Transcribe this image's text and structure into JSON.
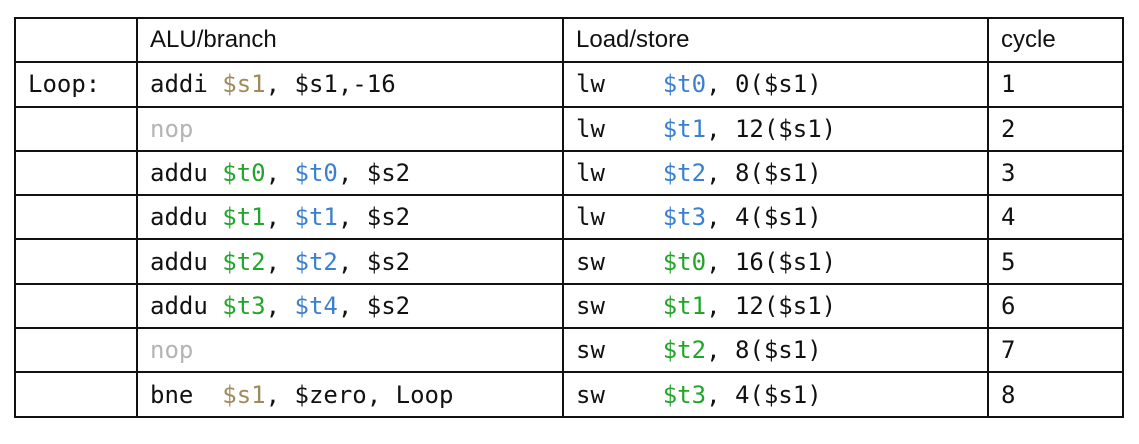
{
  "headers": [
    "",
    "ALU/branch",
    "Load/store",
    "cycle"
  ],
  "colors": {
    "plain": "#111111",
    "gold": "#a08a5a",
    "green": "#22a52a",
    "blue": "#3a7fd0",
    "gray": "#b4b4b4"
  },
  "rows": [
    {
      "label": "Loop:",
      "alu": [
        {
          "t": "addi ",
          "c": "plain"
        },
        {
          "t": "$s1",
          "c": "gold"
        },
        {
          "t": ", $s1,-16",
          "c": "plain"
        }
      ],
      "ls": [
        {
          "t": "lw    ",
          "c": "plain"
        },
        {
          "t": "$t0",
          "c": "blue"
        },
        {
          "t": ", 0($s1)",
          "c": "plain"
        }
      ],
      "cycle": "1"
    },
    {
      "label": "",
      "alu": [
        {
          "t": "nop",
          "c": "gray"
        }
      ],
      "ls": [
        {
          "t": "lw    ",
          "c": "plain"
        },
        {
          "t": "$t1",
          "c": "blue"
        },
        {
          "t": ", 12($s1)",
          "c": "plain"
        }
      ],
      "cycle": "2"
    },
    {
      "label": "",
      "alu": [
        {
          "t": "addu ",
          "c": "plain"
        },
        {
          "t": "$t0",
          "c": "green"
        },
        {
          "t": ", ",
          "c": "plain"
        },
        {
          "t": "$t0",
          "c": "blue"
        },
        {
          "t": ", $s2",
          "c": "plain"
        }
      ],
      "ls": [
        {
          "t": "lw    ",
          "c": "plain"
        },
        {
          "t": "$t2",
          "c": "blue"
        },
        {
          "t": ", 8($s1)",
          "c": "plain"
        }
      ],
      "cycle": "3"
    },
    {
      "label": "",
      "alu": [
        {
          "t": "addu ",
          "c": "plain"
        },
        {
          "t": "$t1",
          "c": "green"
        },
        {
          "t": ", ",
          "c": "plain"
        },
        {
          "t": "$t1",
          "c": "blue"
        },
        {
          "t": ", $s2",
          "c": "plain"
        }
      ],
      "ls": [
        {
          "t": "lw    ",
          "c": "plain"
        },
        {
          "t": "$t3",
          "c": "blue"
        },
        {
          "t": ", 4($s1)",
          "c": "plain"
        }
      ],
      "cycle": "4"
    },
    {
      "label": "",
      "alu": [
        {
          "t": "addu ",
          "c": "plain"
        },
        {
          "t": "$t2",
          "c": "green"
        },
        {
          "t": ", ",
          "c": "plain"
        },
        {
          "t": "$t2",
          "c": "blue"
        },
        {
          "t": ", $s2",
          "c": "plain"
        }
      ],
      "ls": [
        {
          "t": "sw    ",
          "c": "plain"
        },
        {
          "t": "$t0",
          "c": "green"
        },
        {
          "t": ", 16($s1)",
          "c": "plain"
        }
      ],
      "cycle": "5"
    },
    {
      "label": "",
      "alu": [
        {
          "t": "addu ",
          "c": "plain"
        },
        {
          "t": "$t3",
          "c": "green"
        },
        {
          "t": ", ",
          "c": "plain"
        },
        {
          "t": "$t4",
          "c": "blue"
        },
        {
          "t": ", $s2",
          "c": "plain"
        }
      ],
      "ls": [
        {
          "t": "sw    ",
          "c": "plain"
        },
        {
          "t": "$t1",
          "c": "green"
        },
        {
          "t": ", 12($s1)",
          "c": "plain"
        }
      ],
      "cycle": "6"
    },
    {
      "label": "",
      "alu": [
        {
          "t": "nop",
          "c": "gray"
        }
      ],
      "ls": [
        {
          "t": "sw    ",
          "c": "plain"
        },
        {
          "t": "$t2",
          "c": "green"
        },
        {
          "t": ", 8($s1)",
          "c": "plain"
        }
      ],
      "cycle": "7"
    },
    {
      "label": "",
      "alu": [
        {
          "t": "bne  ",
          "c": "plain"
        },
        {
          "t": "$s1",
          "c": "gold"
        },
        {
          "t": ", $zero, Loop",
          "c": "plain"
        }
      ],
      "ls": [
        {
          "t": "sw    ",
          "c": "plain"
        },
        {
          "t": "$t3",
          "c": "green"
        },
        {
          "t": ", 4($s1)",
          "c": "plain"
        }
      ],
      "cycle": "8"
    }
  ]
}
